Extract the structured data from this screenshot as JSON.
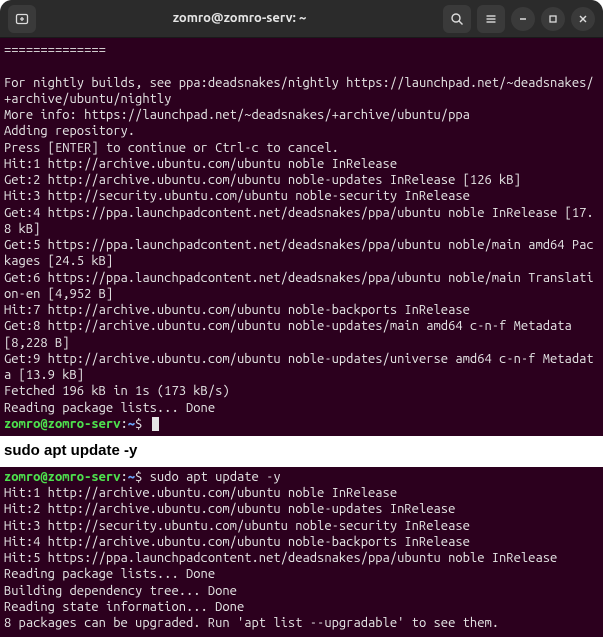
{
  "titlebar": {
    "title": "zomro@zomro-serv: ~"
  },
  "term1": {
    "separator": "==============",
    "lines": [
      "For nightly builds, see ppa:deadsnakes/nightly https://launchpad.net/~deadsnakes/+archive/ubuntu/nightly",
      "More info: https://launchpad.net/~deadsnakes/+archive/ubuntu/ppa",
      "Adding repository.",
      "Press [ENTER] to continue or Ctrl-c to cancel.",
      "Hit:1 http://archive.ubuntu.com/ubuntu noble InRelease",
      "Get:2 http://archive.ubuntu.com/ubuntu noble-updates InRelease [126 kB]",
      "Hit:3 http://security.ubuntu.com/ubuntu noble-security InRelease",
      "Get:4 https://ppa.launchpadcontent.net/deadsnakes/ppa/ubuntu noble InRelease [17.8 kB]",
      "Get:5 https://ppa.launchpadcontent.net/deadsnakes/ppa/ubuntu noble/main amd64 Packages [24.5 kB]",
      "Get:6 https://ppa.launchpadcontent.net/deadsnakes/ppa/ubuntu noble/main Translation-en [4,952 B]",
      "Hit:7 http://archive.ubuntu.com/ubuntu noble-backports InRelease",
      "Get:8 http://archive.ubuntu.com/ubuntu noble-updates/main amd64 c-n-f Metadata [8,228 B]",
      "Get:9 http://archive.ubuntu.com/ubuntu noble-updates/universe amd64 c-n-f Metadata [13.9 kB]",
      "Fetched 196 kB in 1s (173 kB/s)",
      "Reading package lists... Done"
    ],
    "prompt": {
      "user": "zomro@zomro-serv",
      "path": "~",
      "sigil": "$"
    }
  },
  "heading": "sudo apt update -y",
  "term2": {
    "prompt": {
      "user": "zomro@zomro-serv",
      "path": "~",
      "sigil": "$"
    },
    "command": "sudo apt update -y",
    "lines": [
      "Hit:1 http://archive.ubuntu.com/ubuntu noble InRelease",
      "Hit:2 http://archive.ubuntu.com/ubuntu noble-updates InRelease",
      "Hit:3 http://security.ubuntu.com/ubuntu noble-security InRelease",
      "Hit:4 http://archive.ubuntu.com/ubuntu noble-backports InRelease",
      "Hit:5 https://ppa.launchpadcontent.net/deadsnakes/ppa/ubuntu noble InRelease",
      "Reading package lists... Done",
      "Building dependency tree... Done",
      "Reading state information... Done",
      "8 packages can be upgraded. Run 'apt list --upgradable' to see them."
    ]
  }
}
